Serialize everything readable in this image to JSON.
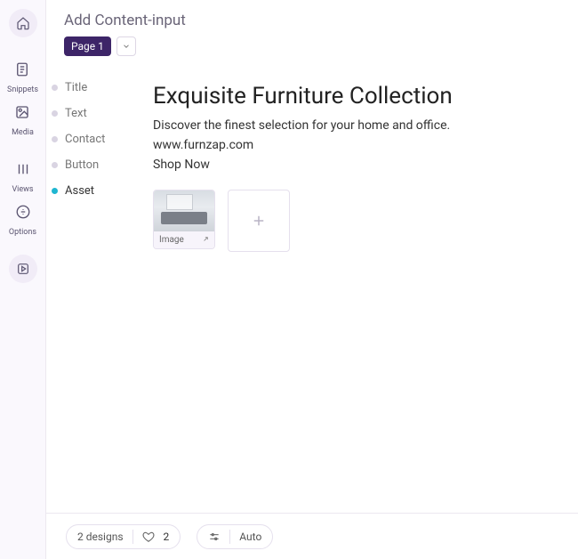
{
  "header": {
    "title": "Add Content-input",
    "page_badge": "Page 1"
  },
  "sidebar": {
    "items": [
      {
        "id": "snippets",
        "label": "Snippets"
      },
      {
        "id": "media",
        "label": "Media"
      },
      {
        "id": "views",
        "label": "Views"
      },
      {
        "id": "options",
        "label": "Options"
      }
    ]
  },
  "nav": {
    "items": [
      {
        "id": "title",
        "label": "Title",
        "active": false
      },
      {
        "id": "text",
        "label": "Text",
        "active": false
      },
      {
        "id": "contact",
        "label": "Contact",
        "active": false
      },
      {
        "id": "button",
        "label": "Button",
        "active": false
      },
      {
        "id": "asset",
        "label": "Asset",
        "active": true
      }
    ]
  },
  "content": {
    "title": "Exquisite Furniture Collection",
    "text": "Discover the finest selection for your home and office.",
    "contact": "www.furnzap.com",
    "button_label": "Shop Now",
    "asset": {
      "label": "Image"
    }
  },
  "footer": {
    "designs_label": "2 designs",
    "like_count": "2",
    "auto_label": "Auto"
  }
}
